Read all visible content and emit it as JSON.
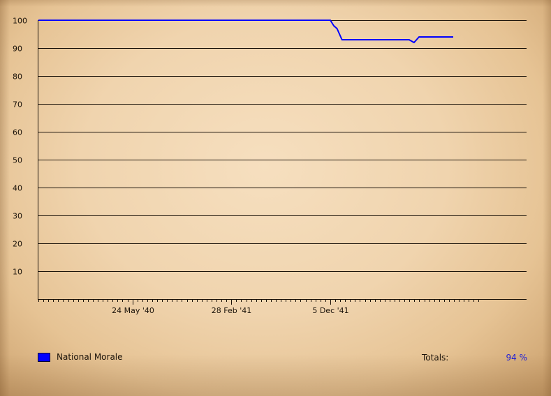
{
  "chart_data": {
    "type": "line",
    "title": "",
    "xlabel": "",
    "ylabel": "",
    "ylim": [
      0,
      100
    ],
    "yticks": [
      10,
      20,
      30,
      40,
      50,
      60,
      70,
      80,
      90,
      100
    ],
    "xlim": [
      "1939-09-01",
      "1943-02-01"
    ],
    "xticks": [
      {
        "date": "1940-05-24",
        "label": "24 May '40"
      },
      {
        "date": "1941-02-28",
        "label": "28 Feb '41"
      },
      {
        "date": "1941-12-05",
        "label": "5 Dec '41"
      }
    ],
    "grid": true,
    "legend_placement": "bottom-left",
    "series": [
      {
        "name": "National Morale",
        "color": "#0000ff",
        "points": [
          [
            "1939-09-01",
            100
          ],
          [
            "1941-12-05",
            100
          ],
          [
            "1941-12-15",
            98
          ],
          [
            "1941-12-24",
            97
          ],
          [
            "1942-01-07",
            93
          ],
          [
            "1942-03-21",
            93
          ],
          [
            "1942-07-16",
            93
          ],
          [
            "1942-07-30",
            92
          ],
          [
            "1942-08-13",
            94
          ],
          [
            "1942-11-18",
            94
          ]
        ]
      }
    ]
  },
  "legend": {
    "label": "National Morale",
    "color": "#0000ff"
  },
  "totals": {
    "label": "Totals:",
    "value": "94 %"
  }
}
